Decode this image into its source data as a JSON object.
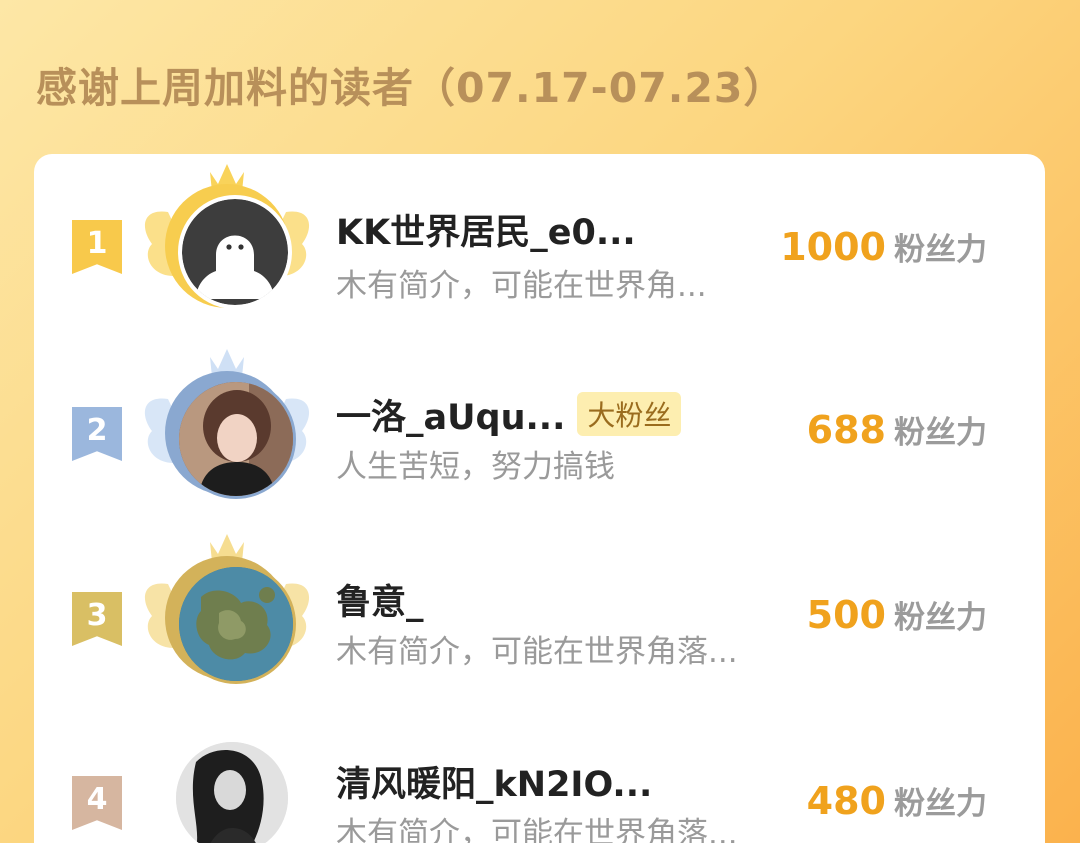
{
  "page_title": "感谢上周加料的读者（07.17-07.23）",
  "colors": {
    "background_start": "#fde7a6",
    "background_end": "#fbb24d",
    "title": "#b8905a",
    "score": "#f0a21d",
    "rank_1": "#f8c94b",
    "rank_2": "#9bb7dd",
    "rank_3": "#d9bf64",
    "rank_4": "#d6b6a0"
  },
  "readers": [
    {
      "rank": "1",
      "name": "KK世界居民_e0...",
      "tag": "",
      "bio": "木有简介，可能在世界角...",
      "score": "1000",
      "unit": "粉丝力",
      "avatar_icon": "ghost-figure-icon"
    },
    {
      "rank": "2",
      "name": "一洛_aUqu...",
      "tag": "大粉丝",
      "bio": "人生苦短，努力搞钱",
      "score": "688",
      "unit": "粉丝力",
      "avatar_icon": "portrait-photo"
    },
    {
      "rank": "3",
      "name": "鲁意_",
      "tag": "",
      "bio": "木有简介，可能在世界角落...",
      "score": "500",
      "unit": "粉丝力",
      "avatar_icon": "island-map-photo"
    },
    {
      "rank": "4",
      "name": "清风暖阳_kN2IO...",
      "tag": "",
      "bio": "木有简介，可能在世界角落...",
      "score": "480",
      "unit": "粉丝力",
      "avatar_icon": "bw-portrait-photo"
    }
  ]
}
